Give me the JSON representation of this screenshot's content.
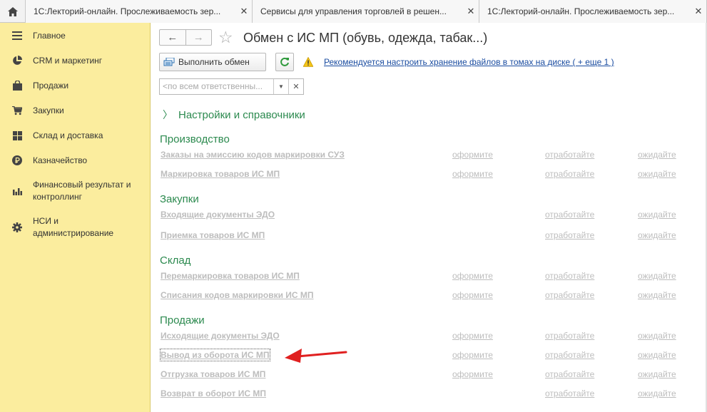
{
  "tabs": [
    {
      "label": "1С:Лекторий-онлайн. Прослеживаемость зер..."
    },
    {
      "label": "Сервисы для управления торговлей в решен..."
    },
    {
      "label": "1С:Лекторий-онлайн. Прослеживаемость зер..."
    }
  ],
  "sidebar": {
    "items": [
      {
        "label": "Главное",
        "icon": "menu-icon"
      },
      {
        "label": "CRM и маркетинг",
        "icon": "pie-chart-icon"
      },
      {
        "label": "Продажи",
        "icon": "shopping-bag-icon"
      },
      {
        "label": "Закупки",
        "icon": "cart-icon"
      },
      {
        "label": "Склад и доставка",
        "icon": "grid-icon"
      },
      {
        "label": "Казначейство",
        "icon": "ruble-icon"
      },
      {
        "label": "Финансовый результат и контроллинг",
        "icon": "bar-chart-icon"
      },
      {
        "label": "НСИ и администрирование",
        "icon": "gear-icon"
      }
    ]
  },
  "header": {
    "title": "Обмен с ИС МП (обувь, одежда, табак...)"
  },
  "toolbar": {
    "exec_label": "Выполнить обмен",
    "warning_link": "Рекомендуется настроить хранение файлов в томах на диске ( + еще 1 )"
  },
  "filter": {
    "placeholder": "<по всем ответственны..."
  },
  "settings_label": "Настройки и справочники",
  "status_labels": {
    "draft": "оформите",
    "process": "отработайте",
    "wait": "ожидайте"
  },
  "sections": [
    {
      "title": "Производство",
      "rows": [
        {
          "label": "Заказы на эмиссию кодов маркировки СУЗ",
          "draft": "оформите",
          "process": "отработайте",
          "wait": "ожидайте"
        },
        {
          "label": "Маркировка товаров ИС МП",
          "draft": "оформите",
          "process": "отработайте",
          "wait": "ожидайте"
        }
      ]
    },
    {
      "title": "Закупки",
      "rows": [
        {
          "label": "Входящие документы ЭДО",
          "draft": "",
          "process": "отработайте",
          "wait": "ожидайте"
        },
        {
          "label": "Приемка товаров ИС МП",
          "draft": "",
          "process": "отработайте",
          "wait": "ожидайте"
        }
      ]
    },
    {
      "title": "Склад",
      "rows": [
        {
          "label": "Перемаркировка товаров ИС МП",
          "draft": "оформите",
          "process": "отработайте",
          "wait": "ожидайте"
        },
        {
          "label": "Списания кодов маркировки ИС МП",
          "draft": "оформите",
          "process": "отработайте",
          "wait": "ожидайте"
        }
      ]
    },
    {
      "title": "Продажи",
      "rows": [
        {
          "label": "Исходящие документы ЭДО",
          "draft": "оформите",
          "process": "отработайте",
          "wait": "ожидайте"
        },
        {
          "label": "Вывод из оборота ИС МП",
          "draft": "оформите",
          "process": "отработайте",
          "wait": "ожидайте"
        },
        {
          "label": "Отгрузка товаров ИС МП",
          "draft": "оформите",
          "process": "отработайте",
          "wait": "ожидайте"
        },
        {
          "label": "Возврат в оборот ИС МП",
          "draft": "",
          "process": "отработайте",
          "wait": "ожидайте"
        }
      ]
    }
  ],
  "colors": {
    "sidebar_bg": "#fbed9e",
    "section_green": "#2c8a4f",
    "link_blue": "#1a4ca0",
    "disabled_gray": "#bdbdbd",
    "arrow_red": "#e02020"
  }
}
